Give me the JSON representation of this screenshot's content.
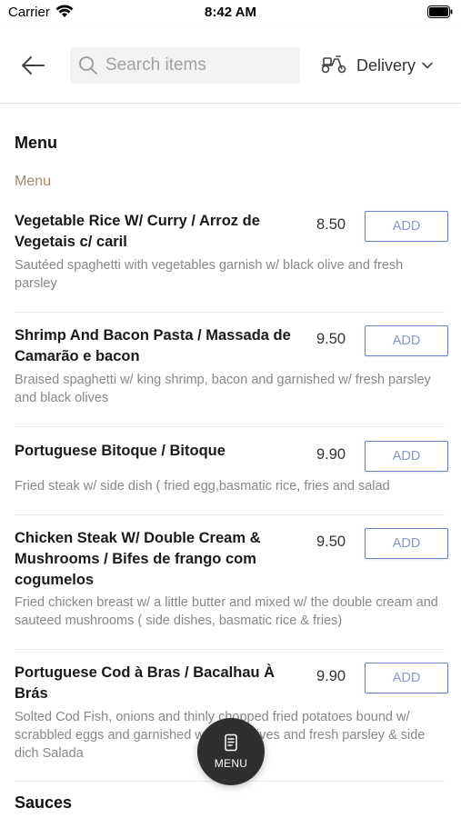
{
  "status_bar": {
    "carrier": "Carrier",
    "time": "8:42 AM"
  },
  "header": {
    "search_placeholder": "Search items",
    "delivery_label": "Delivery"
  },
  "menu": {
    "title": "Menu",
    "category": "Menu",
    "items": [
      {
        "name": "Vegetable Rice W/ Curry / Arroz de Vegetais c/ caril",
        "price": "8.50",
        "add_label": "ADD",
        "description": "Sautéed spaghetti with vegetables garnish w/ black olive and fresh parsley"
      },
      {
        "name": "Shrimp And Bacon Pasta / Massada de Camarão e bacon",
        "price": "9.50",
        "add_label": "ADD",
        "description": "Braised spaghetti w/ king shrimp, bacon and garnished w/ fresh parsley and black olives"
      },
      {
        "name": "Portuguese Bitoque / Bitoque",
        "price": "9.90",
        "add_label": "ADD",
        "description": "Fried steak w/ side dish ( fried egg,basmatic rice, fries and salad"
      },
      {
        "name": "Chicken Steak W/ Double Cream & Mushrooms / Bifes de frango com cogumelos",
        "price": "9.50",
        "add_label": "ADD",
        "description": " Fried chicken breast w/ a little butter and mixed w/ the double cream and sauteed mushrooms ( side dishes, basmatic rice & fries)"
      },
      {
        "name": "Portuguese Cod à Bras / Bacalhau À Brás",
        "price": "9.90",
        "add_label": "ADD",
        "description": "Solted Cod Fish, onions and thinly chopped fried potatoes bound w/ scrabbled eggs and garnished w/ black olives and fresh parsley & side dich Salada"
      }
    ],
    "next_section": "Sauces"
  },
  "fab": {
    "label": "MENU"
  },
  "colors": {
    "accent": "#6d80c8",
    "category": "#a08d6e",
    "fab": "#2f2f2f"
  },
  "icons": [
    "wifi-icon",
    "battery-icon",
    "back-arrow-icon",
    "search-icon",
    "scooter-icon",
    "chevron-down-icon",
    "menu-doc-icon"
  ]
}
